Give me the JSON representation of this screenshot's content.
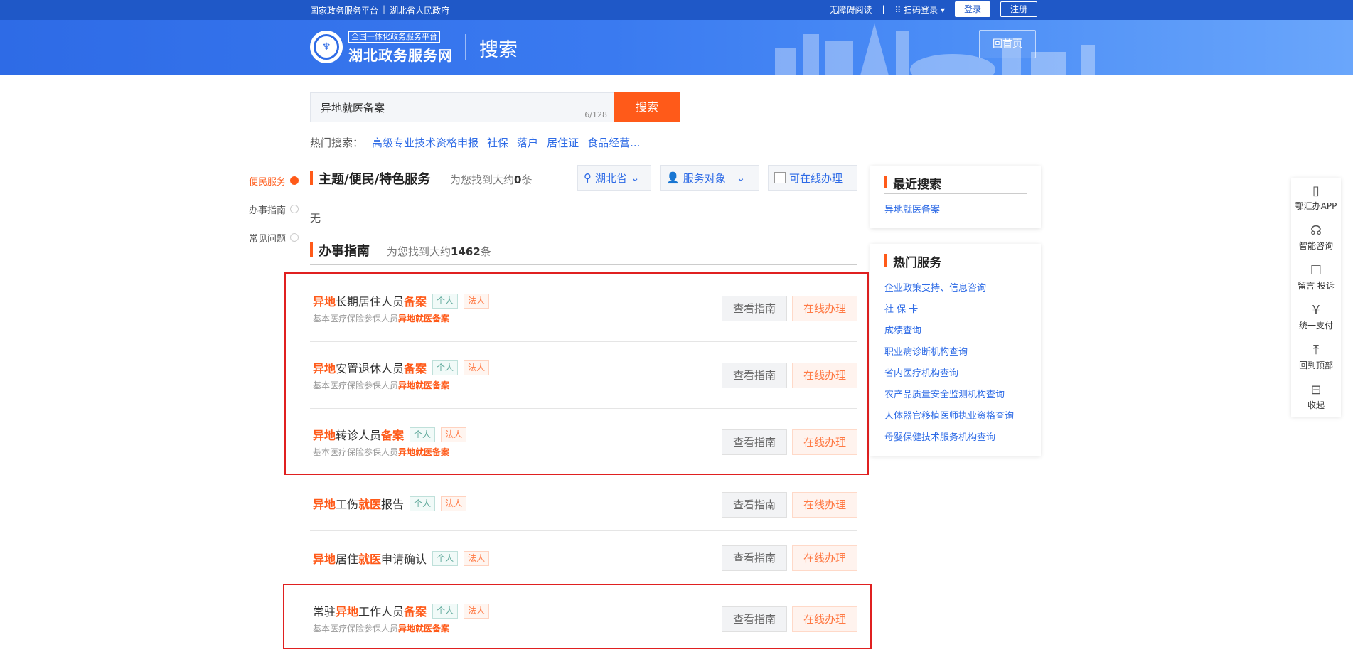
{
  "topbar": {
    "link1": "国家政务服务平台",
    "link2": "湖北省人民政府",
    "accessible": "无障碍阅读",
    "scan_login": "扫码登录",
    "login": "登录",
    "register": "注册"
  },
  "header": {
    "logo_sub": "全国一体化政务服务平台",
    "logo_main": "湖北政务服务网",
    "page_title": "搜索",
    "home": "回首页"
  },
  "search": {
    "value": "异地就医备案",
    "count": "6/128",
    "button": "搜索"
  },
  "hot": {
    "label": "热门搜索：",
    "items": [
      "高级专业技术资格申报",
      "社保",
      "落户",
      "居住证",
      "食品经营..."
    ]
  },
  "anchors": [
    "便民服务",
    "办事指南",
    "常见问题"
  ],
  "section1": {
    "title": "主题/便民/特色服务",
    "found_prefix": "为您找到大约",
    "found_count": "0",
    "found_suffix": "条",
    "filter_region": "湖北省",
    "filter_target": "服务对象",
    "filter_online": "可在线办理",
    "empty": "无"
  },
  "section2": {
    "title": "办事指南",
    "found_prefix": "为您找到大约",
    "found_count": "1462",
    "found_suffix": "条"
  },
  "tags": {
    "personal": "个人",
    "legal": "法人"
  },
  "row_buttons": {
    "guide": "查看指南",
    "online": "在线办理"
  },
  "results": [
    {
      "pre": "",
      "h1": "异地",
      "mid": "长期居住人员",
      "h2": "备案",
      "post": "",
      "desc_pre": "基本医疗保险参保人员",
      "desc_hl": "异地就医备案"
    },
    {
      "pre": "",
      "h1": "异地",
      "mid": "安置退休人员",
      "h2": "备案",
      "post": "",
      "desc_pre": "基本医疗保险参保人员",
      "desc_hl": "异地就医备案"
    },
    {
      "pre": "",
      "h1": "异地",
      "mid": "转诊人员",
      "h2": "备案",
      "post": "",
      "desc_pre": "基本医疗保险参保人员",
      "desc_hl": "异地就医备案"
    },
    {
      "pre": "",
      "h1": "异地",
      "mid": "工伤",
      "h2": "就医",
      "post": "报告",
      "desc_pre": "",
      "desc_hl": ""
    },
    {
      "pre": "",
      "h1": "异地",
      "mid": "居住",
      "h2": "就医",
      "post": "申请确认",
      "desc_pre": "",
      "desc_hl": ""
    },
    {
      "pre": "常驻",
      "h1": "异地",
      "mid": "工作人员",
      "h2": "备案",
      "post": "",
      "desc_pre": "基本医疗保险参保人员",
      "desc_hl": "异地就医备案"
    }
  ],
  "recent": {
    "title": "最近搜索",
    "items": [
      "异地就医备案"
    ]
  },
  "hot_services": {
    "title": "热门服务",
    "items": [
      "企业政策支持、信息咨询",
      "社 保 卡",
      "成绩查询",
      "职业病诊断机构查询",
      "省内医疗机构查询",
      "农产品质量安全监测机构查询",
      "人体器官移植医师执业资格查询",
      "母婴保健技术服务机构查询"
    ]
  },
  "tools": [
    {
      "icon": "phone-icon",
      "label": "鄂汇办APP"
    },
    {
      "icon": "headset-icon",
      "label": "智能咨询"
    },
    {
      "icon": "message-icon",
      "label": "留言 投诉"
    },
    {
      "icon": "yen-icon",
      "label": "统一支付"
    },
    {
      "icon": "arrow-up-icon",
      "label": "回到顶部"
    },
    {
      "icon": "collapse-icon",
      "label": "收起"
    }
  ]
}
